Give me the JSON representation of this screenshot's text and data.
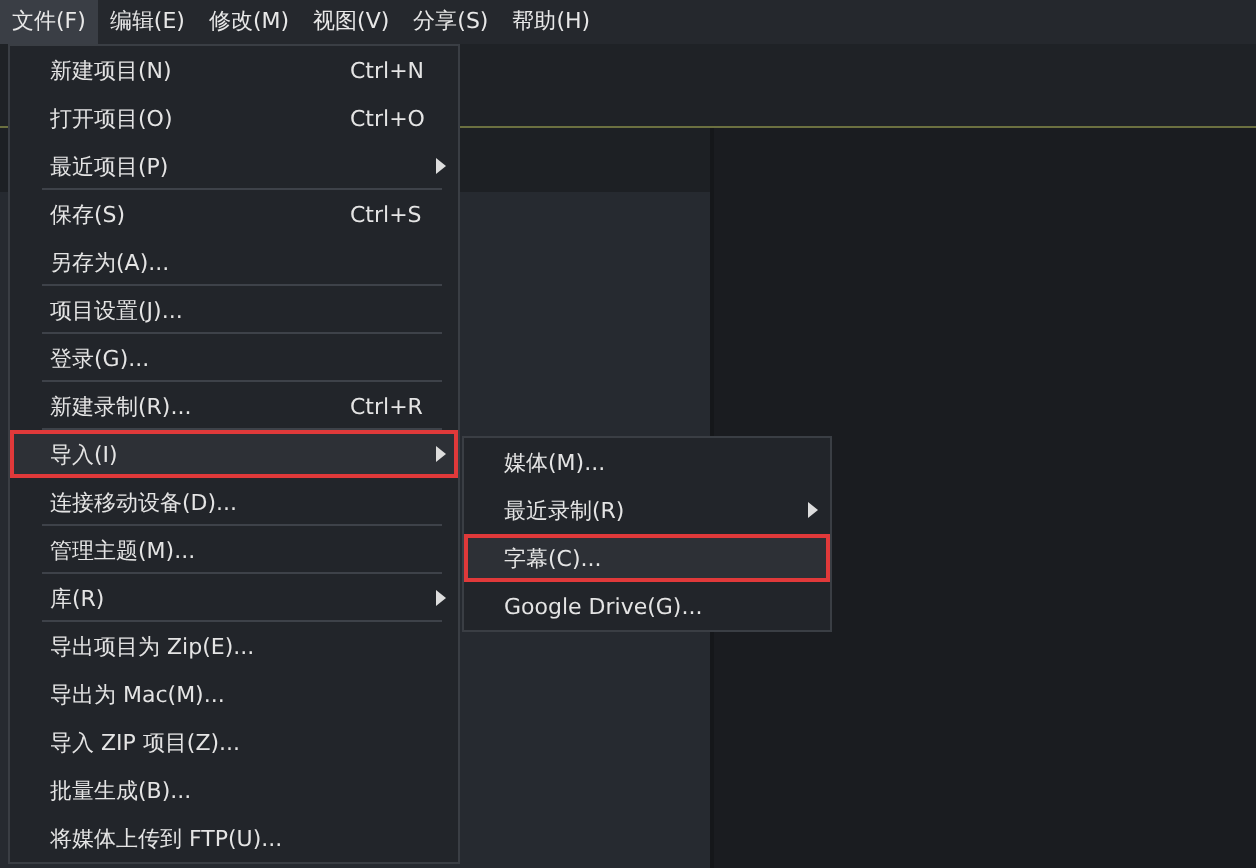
{
  "menubar": [
    {
      "label": "文件(F)",
      "selected": true
    },
    {
      "label": "编辑(E)",
      "selected": false
    },
    {
      "label": "修改(M)",
      "selected": false
    },
    {
      "label": "视图(V)",
      "selected": false
    },
    {
      "label": "分享(S)",
      "selected": false
    },
    {
      "label": "帮助(H)",
      "selected": false
    }
  ],
  "file_menu": {
    "items": [
      {
        "label": "新建项目(N)",
        "shortcut": "Ctrl+N",
        "has_submenu": false,
        "highlighted": false,
        "separator_after": false
      },
      {
        "label": "打开项目(O)",
        "shortcut": "Ctrl+O",
        "has_submenu": false,
        "highlighted": false,
        "separator_after": false
      },
      {
        "label": "最近项目(P)",
        "has_submenu": true,
        "highlighted": false,
        "separator_after": true
      },
      {
        "label": "保存(S)",
        "shortcut": "Ctrl+S",
        "has_submenu": false,
        "highlighted": false,
        "separator_after": false
      },
      {
        "label": "另存为(A)...",
        "has_submenu": false,
        "highlighted": false,
        "separator_after": true
      },
      {
        "label": "项目设置(J)...",
        "has_submenu": false,
        "highlighted": false,
        "separator_after": true
      },
      {
        "label": "登录(G)...",
        "has_submenu": false,
        "highlighted": false,
        "separator_after": true
      },
      {
        "label": "新建录制(R)...",
        "shortcut": "Ctrl+R",
        "has_submenu": false,
        "highlighted": false,
        "separator_after": true
      },
      {
        "label": "导入(I)",
        "has_submenu": true,
        "highlighted": true,
        "separator_after": false
      },
      {
        "label": "连接移动设备(D)...",
        "has_submenu": false,
        "highlighted": false,
        "separator_after": true
      },
      {
        "label": "管理主题(M)...",
        "has_submenu": false,
        "highlighted": false,
        "separator_after": true
      },
      {
        "label": "库(R)",
        "has_submenu": true,
        "highlighted": false,
        "separator_after": true
      },
      {
        "label": "导出项目为 Zip(E)...",
        "has_submenu": false,
        "highlighted": false,
        "separator_after": false
      },
      {
        "label": "导出为 Mac(M)...",
        "has_submenu": false,
        "highlighted": false,
        "separator_after": false
      },
      {
        "label": "导入 ZIP 项目(Z)...",
        "has_submenu": false,
        "highlighted": false,
        "separator_after": false
      },
      {
        "label": "批量生成(B)...",
        "has_submenu": false,
        "highlighted": false,
        "separator_after": false
      },
      {
        "label": "将媒体上传到 FTP(U)...",
        "has_submenu": false,
        "highlighted": false,
        "separator_after": false
      }
    ]
  },
  "import_submenu": {
    "items": [
      {
        "label": "媒体(M)...",
        "has_submenu": false,
        "highlighted": false
      },
      {
        "label": "最近录制(R)",
        "has_submenu": true,
        "highlighted": false
      },
      {
        "label": "字幕(C)...",
        "has_submenu": false,
        "highlighted": true
      },
      {
        "label": "Google Drive(G)...",
        "has_submenu": false,
        "highlighted": false
      }
    ]
  }
}
